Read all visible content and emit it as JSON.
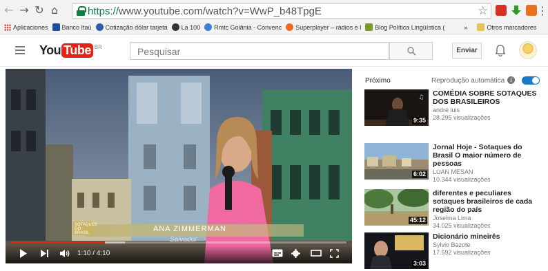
{
  "browser": {
    "url_https": "https://",
    "url_rest": "www.youtube.com/watch?v=WwP_b48TpgE",
    "bookmarks": [
      {
        "label": "Aplicaciones",
        "color": "#c44"
      },
      {
        "label": "Banco Itaú",
        "color": "#1a4fa0"
      },
      {
        "label": "Cotização dólar tarjeta",
        "color": "#2a5db0"
      },
      {
        "label": "La 100",
        "color": "#333333"
      },
      {
        "label": "Rmtc Goiânia - Convenc",
        "color": "#3d7fd1"
      },
      {
        "label": "Superplayer – rádios e l",
        "color": "#f26522"
      },
      {
        "label": "Blog Política Lingüística (",
        "color": "#7a9a2e"
      }
    ],
    "bookmarks_more": "»",
    "other_bookmarks": "Otros marcadores"
  },
  "yt": {
    "logo_you": "You",
    "logo_tube": "Tube",
    "logo_region": "BR",
    "search_placeholder": "Pesquisar",
    "upload_label": "Enviar",
    "accent": "#e62117"
  },
  "player": {
    "lower_third_tag": "SOTAQUES DO BRASIL",
    "reporter_name": "ANA ZIMMERMAN",
    "city": "Salvador",
    "time_current": "1:10",
    "time_total": "4:10",
    "progress_fraction": 0.28
  },
  "sidebar": {
    "next_label": "Próximo",
    "autoplay_label": "Reprodução automática",
    "autoplay_on": true,
    "videos": [
      {
        "title": "COMÉDIA SOBRE SOTAQUES DOS BRASILEIROS",
        "channel": "andré luis",
        "views": "28.295 visualizações",
        "duration": "9:35"
      },
      {
        "title": "Jornal Hoje - Sotaques do Brasil O maior número de pessoas",
        "channel": "LUAN MESAN",
        "views": "10.344 visualizações",
        "duration": "6:02"
      },
      {
        "title": "diferentes e peculiares sotaques brasileiros de cada região do país",
        "channel": "Joselma Lima",
        "views": "34.025 visualizações",
        "duration": "45:12"
      },
      {
        "title": "Dicionário mineirês",
        "channel": "Sylvio Bazote",
        "views": "17.592 visualizações",
        "duration": "3:03"
      }
    ]
  }
}
